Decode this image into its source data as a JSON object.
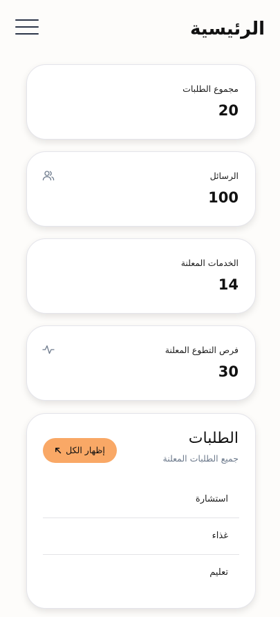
{
  "header": {
    "title": "الرئيسية",
    "menu_icon": "hamburger-menu-icon"
  },
  "stats": [
    {
      "label": "مجموع الطلبات",
      "value": "20",
      "icon": ""
    },
    {
      "label": "الرسائل",
      "value": "100",
      "icon": "users-icon"
    },
    {
      "label": "الخدمات المعلنة",
      "value": "14",
      "icon": ""
    },
    {
      "label": "فرص التطوع المعلنة",
      "value": "30",
      "icon": "activity-icon"
    }
  ],
  "requests": {
    "title": "الطلبات",
    "subtitle": "جميع الطلبات المعلنة",
    "show_all_label": "إظهار الكل",
    "show_all_icon": "arrow-up-left-icon",
    "button_color": "#f9a866",
    "items": [
      {
        "label": "استشارة"
      },
      {
        "label": "غذاء"
      },
      {
        "label": "تعليم"
      }
    ]
  }
}
